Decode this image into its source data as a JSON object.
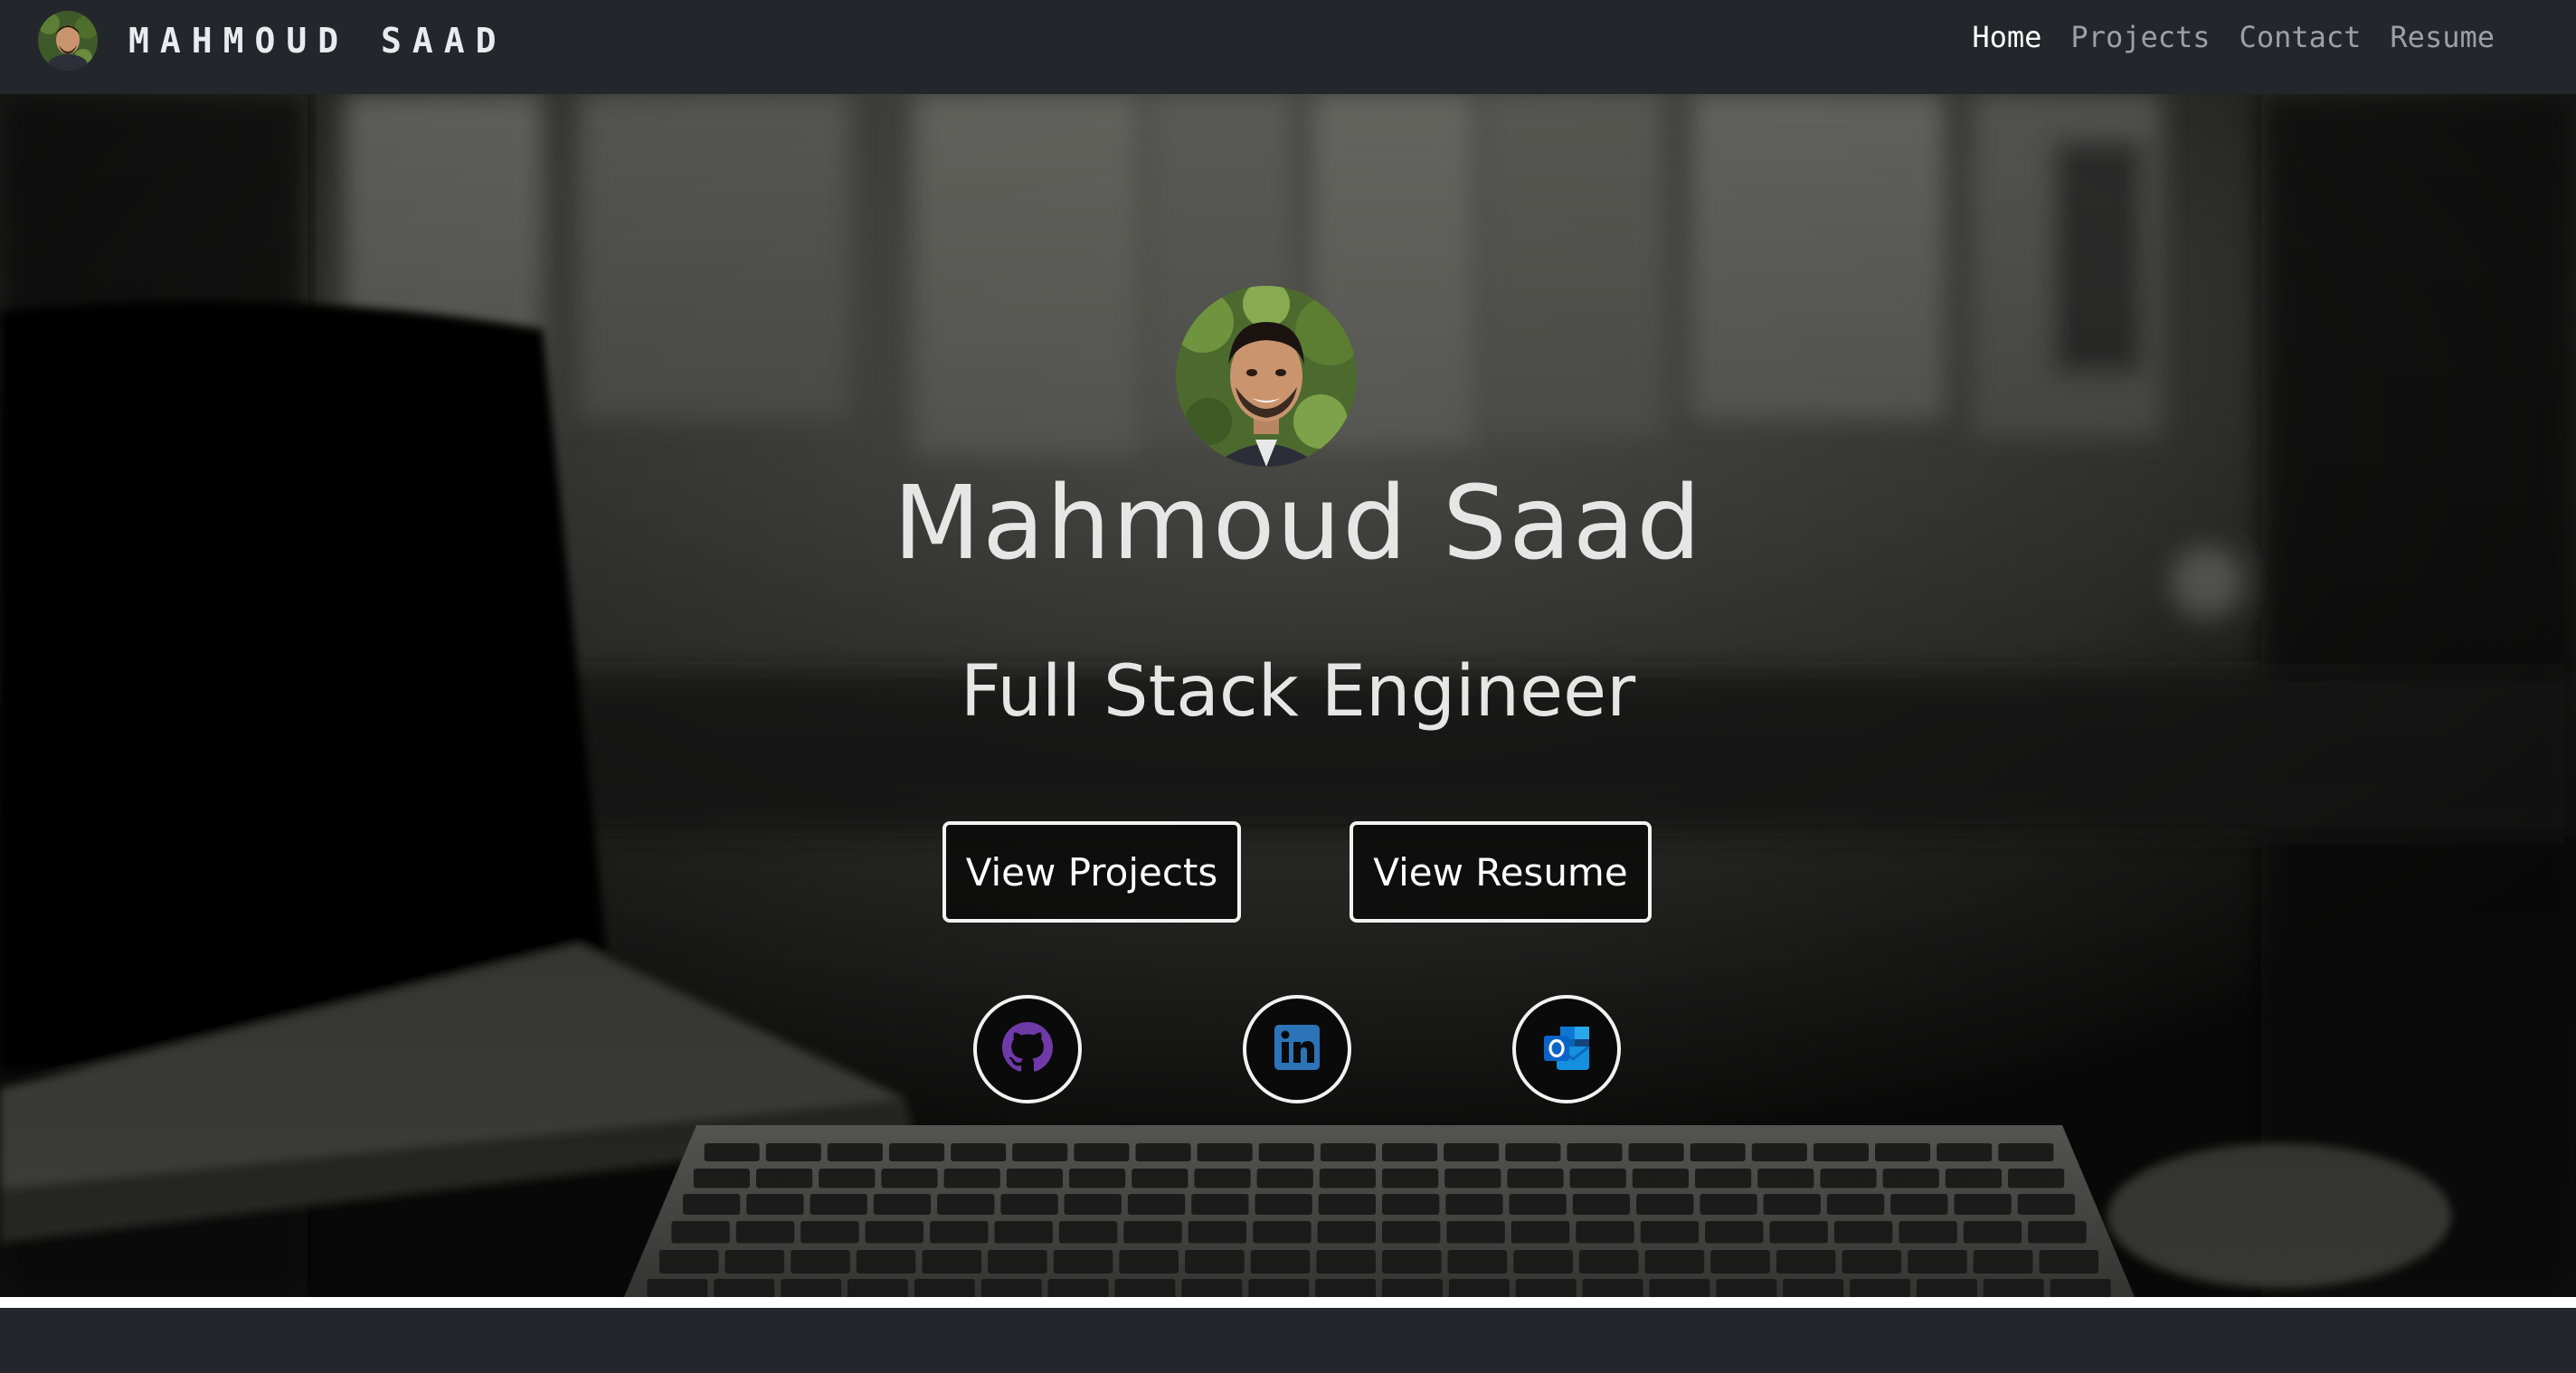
{
  "navbar": {
    "brand_text": "MAHMOUD SAAD",
    "brand_avatar": "profile-photo",
    "links": [
      {
        "label": "Home",
        "active": true
      },
      {
        "label": "Projects",
        "active": false
      },
      {
        "label": "Contact",
        "active": false
      },
      {
        "label": "Resume",
        "active": false
      }
    ]
  },
  "hero": {
    "background": "desk-keyboard-photo",
    "avatar": "profile-photo",
    "name": "Mahmoud Saad",
    "title": "Full Stack Engineer",
    "buttons": {
      "projects_label": "View Projects",
      "resume_label": "View Resume"
    },
    "social": [
      {
        "icon": "github-icon",
        "color": "#6f3aa8"
      },
      {
        "icon": "linkedin-icon",
        "color": "#2c73b8"
      },
      {
        "icon": "outlook-icon",
        "color": "#1e6fd9"
      }
    ]
  },
  "colors": {
    "navbar_bg": "#23272b",
    "text_light": "#e6e6e6",
    "nav_inactive": "#9aa0a6"
  }
}
